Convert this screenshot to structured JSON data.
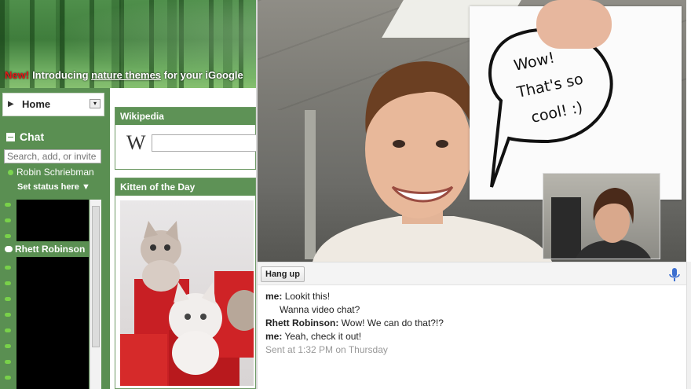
{
  "igoogle": {
    "promo": {
      "new_label": "New!",
      "text_before": "Introducing ",
      "link_text": "nature themes",
      "text_after": " for your iGoogle"
    },
    "home": {
      "label": "Home"
    },
    "chat": {
      "title": "Chat",
      "search_placeholder": "Search, add, or invite",
      "me_name": "Robin Schriebman",
      "status_prompt": "Set status here",
      "contact_name": "Rhett Robinson"
    },
    "gadgets": {
      "wikipedia_title": "Wikipedia",
      "wikipedia_logo": "W",
      "kitten_title": "Kitten of the Day"
    }
  },
  "video_chat": {
    "sign_text_line1": "Wow!",
    "sign_text_line2": "That's so",
    "sign_text_line3": "cool! :)",
    "hangup_label": "Hang up",
    "mic_icon": "microphone-icon",
    "messages": [
      {
        "sender": "me:",
        "text": "Lookit this!"
      },
      {
        "sender": "",
        "text": "Wanna video chat?"
      },
      {
        "sender": "Rhett Robinson:",
        "text": "Wow! We can do that?!?"
      },
      {
        "sender": "me:",
        "text": "Yeah, check it out!"
      }
    ],
    "sent_stamp": "Sent at 1:32 PM on Thursday"
  },
  "colors": {
    "igoogle_green": "#5e9256",
    "presence_green": "#79d14a",
    "new_red": "#e01818",
    "sent_gray": "#999999"
  }
}
